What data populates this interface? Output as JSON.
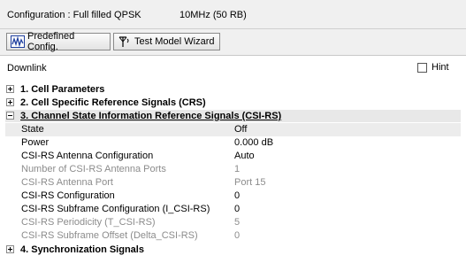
{
  "config": {
    "label": "Configuration : Full filled QPSK",
    "bandwidth": "10MHz (50 RB)"
  },
  "toolbar": {
    "predefined_label": "Predefined Config.",
    "wizard_label": "Test Model Wizard"
  },
  "panel": {
    "title": "Downlink",
    "hint_label": "Hint",
    "hint_checked": false
  },
  "sections": [
    {
      "label": "1. Cell Parameters",
      "expanded": false
    },
    {
      "label": "2. Cell Specific Reference Signals (CRS)",
      "expanded": false
    },
    {
      "label": "3. Channel State Information Reference Signals (CSI-RS)",
      "expanded": true,
      "rows": [
        {
          "key": "State",
          "value": "Off",
          "enabled": true
        },
        {
          "key": "Power",
          "value": "0.000 dB",
          "enabled": true
        },
        {
          "key": "CSI-RS Antenna Configuration",
          "value": "Auto",
          "enabled": true
        },
        {
          "key": "Number of CSI-RS Antenna Ports",
          "value": "1",
          "enabled": false
        },
        {
          "key": "CSI-RS Antenna Port",
          "value": "Port 15",
          "enabled": false
        },
        {
          "key": "CSI-RS Configuration",
          "value": "0",
          "enabled": true
        },
        {
          "key": "CSI-RS Subframe Configuration (I_CSI-RS)",
          "value": "0",
          "enabled": true
        },
        {
          "key": "CSI-RS Periodicity (T_CSI-RS)",
          "value": "5",
          "enabled": false
        },
        {
          "key": "CSI-RS Subframe Offset (Delta_CSI-RS)",
          "value": "0",
          "enabled": false
        }
      ]
    },
    {
      "label": "4. Synchronization Signals",
      "expanded": false
    }
  ],
  "icons": {
    "predefined": "waveform-icon",
    "wizard": "antenna-icon",
    "expand": "plus-box-icon",
    "collapse": "minus-box-icon"
  }
}
